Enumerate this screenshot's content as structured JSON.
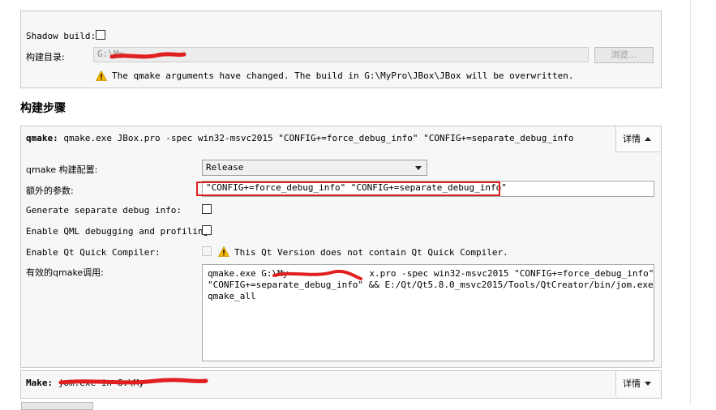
{
  "shadow_build": {
    "label": "Shadow build:"
  },
  "build_dir": {
    "label": "构建目录:",
    "value": "G:\\My",
    "browse_label": "浏览..."
  },
  "warning": {
    "text": "The qmake arguments have changed. The build in G:\\MyPro\\JBox\\JBox will be overwritten."
  },
  "build_steps": {
    "heading": "构建步骤"
  },
  "qmake_step": {
    "title_bold": "qmake:",
    "title_rest": " qmake.exe JBox.pro -spec win32-msvc2015 \"CONFIG+=force_debug_info\" \"CONFIG+=separate_debug_info",
    "details_label": "详情",
    "config_label": "qmake 构建配置:",
    "config_value": "Release",
    "extra_args_label": "额外的参数:",
    "extra_args_value": "\"CONFIG+=force_debug_info\" \"CONFIG+=separate_debug_info\"",
    "sep_debug_label": "Generate separate debug info:",
    "qml_debug_label": "Enable QML debugging and profiling:",
    "quick_compiler_label": "Enable Qt Quick Compiler:",
    "quick_compiler_warning": "This Qt Version does not contain Qt Quick Compiler.",
    "effective_label": "有效的qmake调用:",
    "effective_line1": "qmake.exe G:\\My",
    "effective_line1_rest": "x.pro -spec win32-msvc2015 \"CONFIG+=force_debug_info\"",
    "effective_line2": "\"CONFIG+=separate_debug_info\" && E:/Qt/Qt5.8.0_msvc2015/Tools/QtCreator/bin/jom.exe",
    "effective_line3": "qmake_all"
  },
  "make_step": {
    "title_bold": "Make:",
    "title_rest": " jom.exe in G:\\My",
    "details_label": "详情"
  },
  "colors": {
    "highlight_red": "#e02020",
    "warning_yellow": "#f5b800"
  }
}
